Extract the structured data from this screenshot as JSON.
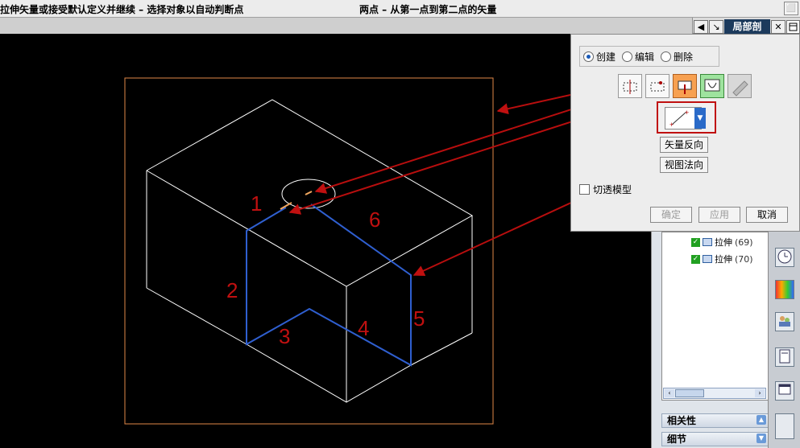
{
  "cue_bar": {
    "left_text": "拉伸矢量或接受默认定义并继续 – 选择对象以自动判断点",
    "right_text": "两点 – 从第一点到第二点的矢量",
    "corner_button": "⬜"
  },
  "toolbar": {
    "title": "局部剖",
    "icons": [
      "◀",
      "↘",
      "✕"
    ]
  },
  "dialog": {
    "radios": [
      {
        "label": "创建",
        "selected": true
      },
      {
        "label": "编辑",
        "selected": false
      },
      {
        "label": "删除",
        "selected": false
      }
    ],
    "buttons": {
      "reverse_vector": "矢量反向",
      "view_normal": "视图法向",
      "cut_model": "切透模型",
      "ok": "确定",
      "apply": "应用",
      "cancel": "取消"
    }
  },
  "canvas": {
    "edge_labels": [
      "1",
      "2",
      "3",
      "4",
      "5",
      "6"
    ]
  },
  "tree": {
    "items": [
      {
        "name": "拉伸",
        "count": "(69)"
      },
      {
        "name": "拉伸",
        "count": "(70)"
      }
    ]
  },
  "panel": {
    "sections": [
      "相关性",
      "细节"
    ]
  },
  "colors": {
    "background": "#000000",
    "wireframe": "#ffffff",
    "highlight_edges": "#2f5fd0",
    "annotation": "#c01010",
    "frame": "#e08848"
  }
}
